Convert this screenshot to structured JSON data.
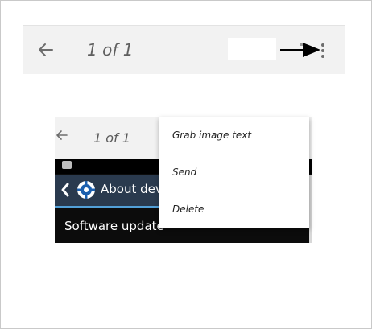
{
  "toolbar": {
    "counter": "1 of 1",
    "icons": {
      "back": "arrow-left-icon",
      "pointer": "black-arrow-pointer-icon",
      "more": "more-vert-icon"
    }
  },
  "screenshot": {
    "counter": "1 of 1",
    "device": {
      "header_title": "About devi",
      "list_item": "Software update",
      "icons": {
        "status": "bbm-icon",
        "back": "chevron-left-icon",
        "settings": "gear-icon"
      },
      "colors": {
        "header_bg": "#2a3a4e",
        "header_accent": "#52a0d8",
        "body_bg": "#0c0c0c"
      }
    },
    "menu": {
      "items": [
        {
          "label": "Grab image text"
        },
        {
          "label": "Send"
        },
        {
          "label": "Delete"
        }
      ]
    }
  },
  "colors": {
    "toolbar_bg": "#f2f2f2",
    "text_secondary": "#5f5f5f"
  }
}
